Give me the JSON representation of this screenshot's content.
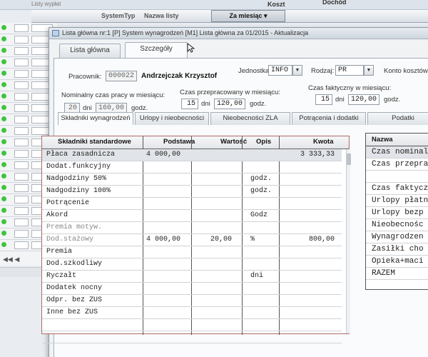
{
  "background_window": {
    "title": "Listy wypłat",
    "columns": [
      "System",
      "Typ",
      "Nazwa listy",
      "Za miesiąc",
      "Koszt",
      "Dochód"
    ],
    "nav_arrows": "◀◀ ◀"
  },
  "dialog": {
    "title": "Lista główna nr:1 [P] System wynagrodzeń [M1] Lista główna za 01/2015 - Aktualizacja",
    "tabs": [
      "Lista główna",
      "Szczegóły"
    ],
    "employee_label": "Pracownik:",
    "employee_id": "000022",
    "employee_name": "Andrzejczak Krzysztof",
    "unit_label": "Jednostka:",
    "unit_value": "INFO",
    "type_label": "Rodzaj:",
    "type_value": "PR",
    "cost_label": "Konto kosztów:",
    "nominal_label": "Nominalny czas pracy w miesiącu:",
    "nominal_days": "20",
    "nominal_days_unit": "dni",
    "nominal_hours": "160,00",
    "nominal_hours_unit": "godz.",
    "worked_label": "Czas przepracowany w miesiącu:",
    "worked_days": "15",
    "worked_days_unit": "dni",
    "worked_hours": "120,00",
    "worked_hours_unit": "godz.",
    "actual_label": "Czas faktyczny w miesiącu:",
    "actual_days": "15",
    "actual_days_unit": "dni",
    "actual_hours": "120,00",
    "actual_hours_unit": "godz."
  },
  "subtabs": [
    "Składniki wynagrodzeń",
    "Urlopy i nieobecności",
    "Nieobecności ZLA",
    "Potrącenia i dodatki",
    "Podatki"
  ],
  "table": {
    "headers": [
      "Składniki standardowe",
      "Podstawa",
      "Wartość",
      "Opis",
      "Kwota"
    ],
    "rows": [
      {
        "name": "Płaca zasadnicza",
        "podstawa": "4 000,00",
        "wartosc": "",
        "opis": "",
        "kwota": "3 333,33"
      },
      {
        "name": "Dodat.funkcyjny",
        "podstawa": "",
        "wartosc": "",
        "opis": "",
        "kwota": ""
      },
      {
        "name": "Nadgodziny 50%",
        "podstawa": "",
        "wartosc": "",
        "opis": "godz.",
        "kwota": ""
      },
      {
        "name": "Nadgodziny 100%",
        "podstawa": "",
        "wartosc": "",
        "opis": "godz.",
        "kwota": ""
      },
      {
        "name": "Potrącenie",
        "podstawa": "",
        "wartosc": "",
        "opis": "",
        "kwota": ""
      },
      {
        "name": "Akord",
        "podstawa": "",
        "wartosc": "",
        "opis": "Godz",
        "kwota": ""
      },
      {
        "name": "Premia motyw.",
        "podstawa": "",
        "wartosc": "",
        "opis": "",
        "kwota": ""
      },
      {
        "name": "Dod.stażowy",
        "podstawa": "4 000,00",
        "wartosc": "20,00",
        "opis": "%",
        "kwota": "800,00"
      },
      {
        "name": "Premia",
        "podstawa": "",
        "wartosc": "",
        "opis": "",
        "kwota": ""
      },
      {
        "name": "Dod.szkodliwy",
        "podstawa": "",
        "wartosc": "",
        "opis": "",
        "kwota": ""
      },
      {
        "name": "Ryczałt",
        "podstawa": "",
        "wartosc": "",
        "opis": "dni",
        "kwota": ""
      },
      {
        "name": "Dodatek nocny",
        "podstawa": "",
        "wartosc": "",
        "opis": "",
        "kwota": ""
      },
      {
        "name": "Odpr. bez ZUS",
        "podstawa": "",
        "wartosc": "",
        "opis": "",
        "kwota": ""
      },
      {
        "name": "Inne bez ZUS",
        "podstawa": "",
        "wartosc": "",
        "opis": "",
        "kwota": ""
      },
      {
        "name": "",
        "podstawa": "",
        "wartosc": "",
        "opis": "",
        "kwota": ""
      },
      {
        "name": "",
        "podstawa": "",
        "wartosc": "",
        "opis": "",
        "kwota": ""
      }
    ]
  },
  "right_table": {
    "header": "Nazwa",
    "rows": [
      "Czas nominal",
      "Czas przepra",
      "",
      "Czas faktycz",
      "Urlopy płatn",
      "Urlopy bezp",
      "Nieobecnośc",
      "Wynagrodzen",
      "Zasiłki cho",
      "Opieka+maci",
      "RAZEM"
    ]
  }
}
